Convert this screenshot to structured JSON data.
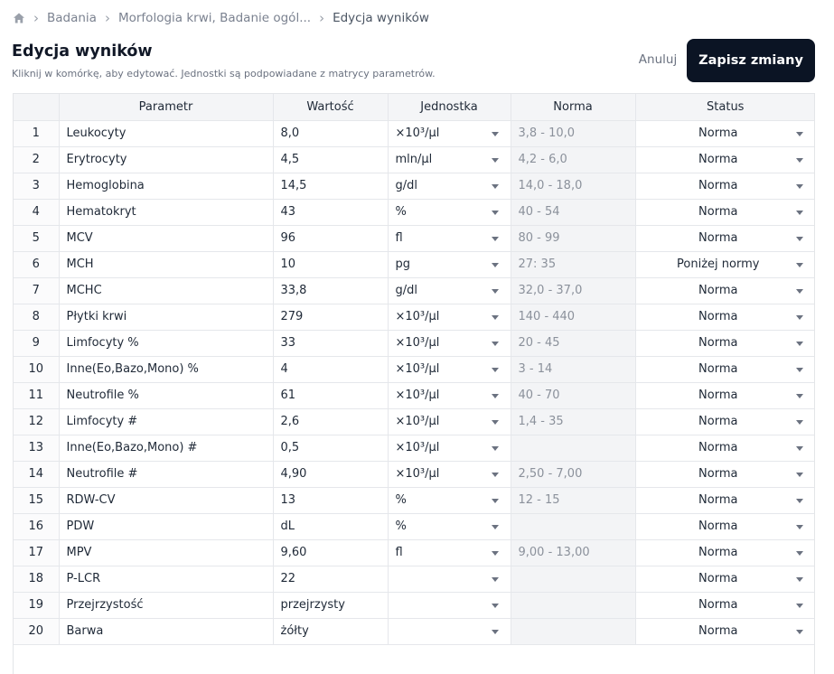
{
  "breadcrumb": {
    "items": [
      "Badania",
      "Morfologia krwi, Badanie ogól...",
      "Edycja wyników"
    ]
  },
  "header": {
    "title": "Edycja wyników",
    "subtitle": "Kliknij w komórkę, aby edytować. Jednostki są podpowiadane z matrycy parametrów.",
    "cancel_label": "Anuluj",
    "save_label": "Zapisz zmiany"
  },
  "table": {
    "columns": [
      "",
      "Parametr",
      "Wartość",
      "Jednostka",
      "Norma",
      "Status"
    ],
    "rows": [
      {
        "idx": "1",
        "param": "Leukocyty",
        "value": "8,0",
        "unit": "×10³/µl",
        "norm": "3,8 - 10,0",
        "status": "Norma"
      },
      {
        "idx": "2",
        "param": "Erytrocyty",
        "value": "4,5",
        "unit": "mln/µl",
        "norm": "4,2 - 6,0",
        "status": "Norma"
      },
      {
        "idx": "3",
        "param": "Hemoglobina",
        "value": "14,5",
        "unit": "g/dl",
        "norm": "14,0 - 18,0",
        "status": "Norma"
      },
      {
        "idx": "4",
        "param": "Hematokryt",
        "value": "43",
        "unit": "%",
        "norm": "40 - 54",
        "status": "Norma"
      },
      {
        "idx": "5",
        "param": "MCV",
        "value": "96",
        "unit": "fl",
        "norm": "80 - 99",
        "status": "Norma"
      },
      {
        "idx": "6",
        "param": "MCH",
        "value": "10",
        "unit": "pg",
        "norm": "27: 35",
        "status": "Poniżej normy"
      },
      {
        "idx": "7",
        "param": "MCHC",
        "value": "33,8",
        "unit": "g/dl",
        "norm": "32,0 - 37,0",
        "status": "Norma"
      },
      {
        "idx": "8",
        "param": "Płytki krwi",
        "value": "279",
        "unit": "×10³/µl",
        "norm": "140 - 440",
        "status": "Norma"
      },
      {
        "idx": "9",
        "param": "Limfocyty %",
        "value": "33",
        "unit": "×10³/µl",
        "norm": "20 - 45",
        "status": "Norma"
      },
      {
        "idx": "10",
        "param": "Inne(Eo,Bazo,Mono) %",
        "value": "4",
        "unit": "×10³/µl",
        "norm": "3 - 14",
        "status": "Norma"
      },
      {
        "idx": "11",
        "param": "Neutrofile %",
        "value": "61",
        "unit": "×10³/µl",
        "norm": "40 - 70",
        "status": "Norma"
      },
      {
        "idx": "12",
        "param": "Limfocyty #",
        "value": "2,6",
        "unit": "×10³/µl",
        "norm": "1,4 - 35",
        "status": "Norma"
      },
      {
        "idx": "13",
        "param": "Inne(Eo,Bazo,Mono) #",
        "value": "0,5",
        "unit": "×10³/µl",
        "norm": "",
        "status": "Norma"
      },
      {
        "idx": "14",
        "param": "Neutrofile #",
        "value": "4,90",
        "unit": "×10³/µl",
        "norm": "2,50 - 7,00",
        "status": "Norma"
      },
      {
        "idx": "15",
        "param": "RDW-CV",
        "value": "13",
        "unit": "%",
        "norm": "12 - 15",
        "status": "Norma"
      },
      {
        "idx": "16",
        "param": "PDW",
        "value": "dL",
        "unit": "%",
        "norm": "",
        "status": "Norma"
      },
      {
        "idx": "17",
        "param": "MPV",
        "value": "9,60",
        "unit": "fl",
        "norm": "9,00 - 13,00",
        "status": "Norma"
      },
      {
        "idx": "18",
        "param": "P-LCR",
        "value": "22",
        "unit": "",
        "norm": "",
        "status": "Norma"
      },
      {
        "idx": "19",
        "param": "Przejrzystość",
        "value": "przejrzysty",
        "unit": "",
        "norm": "",
        "status": "Norma"
      },
      {
        "idx": "20",
        "param": "Barwa",
        "value": "żółty",
        "unit": "",
        "norm": "",
        "status": "Norma"
      }
    ]
  },
  "icons": {
    "home": "home-icon",
    "separator": "chevron-right-icon",
    "dropdown": "caret-down-icon"
  },
  "colors": {
    "primary_button": "#0b1424",
    "norm_cell_bg": "#f3f4f6",
    "header_bg": "#f4f5f7"
  }
}
